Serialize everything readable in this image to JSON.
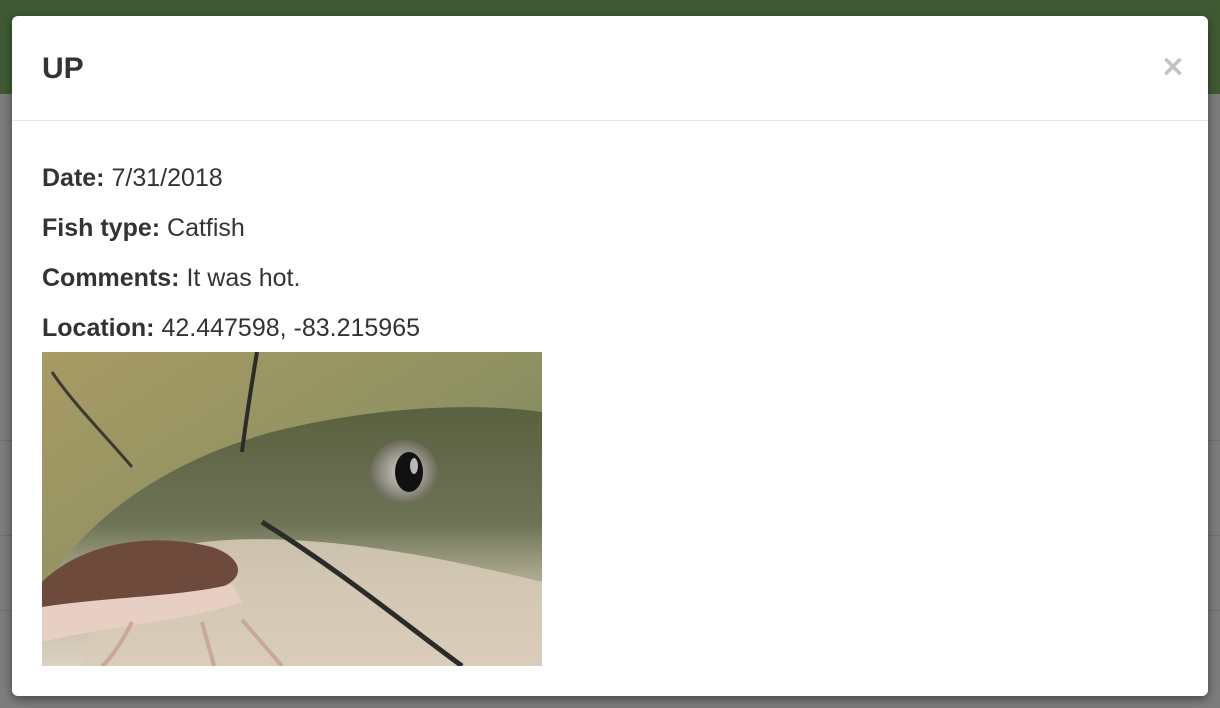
{
  "modal": {
    "title": "UP",
    "close_label": "×"
  },
  "details": {
    "date_label": "Date:",
    "date_value": "7/31/2018",
    "fish_type_label": "Fish type:",
    "fish_type_value": "Catfish",
    "comments_label": "Comments:",
    "comments_value": "It was hot.",
    "location_label": "Location:",
    "location_value": "42.447598, -83.215965"
  },
  "photo": {
    "alt": "Catfish"
  },
  "colors": {
    "header_green": "#3f5a33",
    "text": "#333333",
    "close": "#c3c3c3"
  }
}
